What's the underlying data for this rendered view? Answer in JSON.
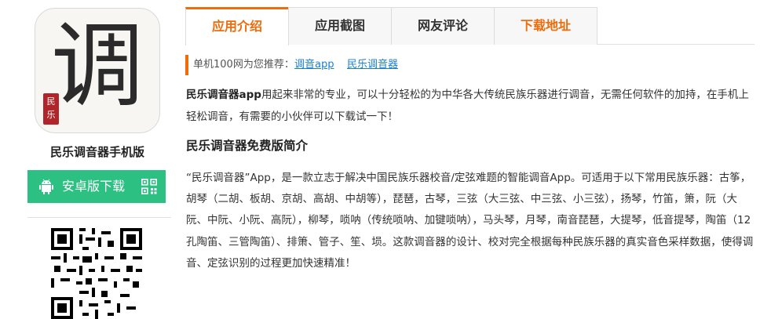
{
  "app": {
    "icon_glyph": "调",
    "icon_seal": "民乐",
    "name": "民乐调音器手机版",
    "download_label": "安卓版下载"
  },
  "tabs": [
    {
      "label": "应用介绍",
      "active": true
    },
    {
      "label": "应用截图",
      "active": false
    },
    {
      "label": "网友评论",
      "active": false
    },
    {
      "label": "下载地址",
      "active": false
    }
  ],
  "recommend": {
    "prefix": "单机100网为您推荐：",
    "links": [
      "调音app",
      "民乐调音器"
    ]
  },
  "intro": {
    "bold": "民乐调音器app",
    "text": "用起来非常的专业，可以十分轻松的为中华各大传统民族乐器进行调音，无需任何软件的加持，在手机上轻松调音，有需要的小伙伴可以下载试一下！"
  },
  "section_title": "民乐调音器免费版简介",
  "body_text": "“民乐调音器”App，是一款立志于解决中国民族乐器校音/定弦难题的智能调音App。可适用于以下常用民族乐器：古筝，胡琴（二胡、板胡、京胡、高胡、中胡等），琵琶，古琴，三弦（大三弦、中三弦、小三弦），扬琴，竹笛，箫，阮（大阮、中阮、小阮、高阮），柳琴，唢呐（传统唢呐、加键唢呐），马头琴，月琴，南音琵琶，大提琴，低音提琴，陶笛（12孔陶笛、三管陶笛）、排箫、管子、笙、埙。这款调音器的设计、校对完全根据每种民族乐器的真实音色采样数据，使得调音、定弦识别的过程更加快速精准！",
  "colors": {
    "accent": "#f06b0a",
    "download": "#2cc083",
    "link": "#1a7fd3"
  },
  "icons": [
    "android-icon",
    "qr-mini-icon",
    "qr-code"
  ]
}
